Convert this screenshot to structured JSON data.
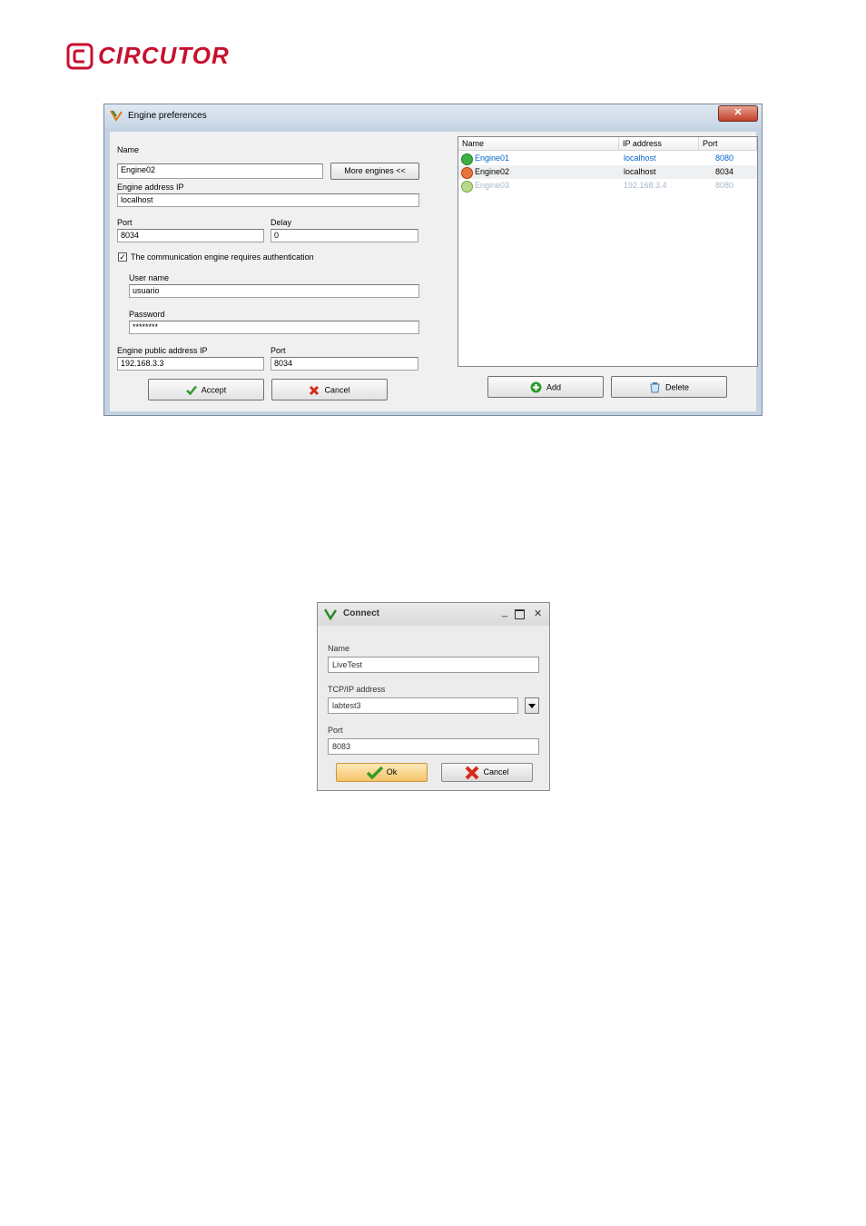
{
  "brand": {
    "name": "CIRCUTOR",
    "color": "#c8102e"
  },
  "engine_prefs": {
    "title": "Engine preferences",
    "close_glyph": "✕",
    "name_label": "Name",
    "name_value": "Engine02",
    "more_engines_label": "More engines <<",
    "address_label": "Engine address IP",
    "address_value": "localhost",
    "port_label": "Port",
    "port_value": "8034",
    "delay_label": "Delay",
    "delay_value": "0",
    "auth_label": "The communication engine requires authentication",
    "auth_checked": true,
    "user_label": "User name",
    "user_value": "usuario",
    "password_label": "Password",
    "password_value": "********",
    "public_ip_label": "Engine public address IP",
    "public_ip_value": "192.168.3.3",
    "public_port_label": "Port",
    "public_port_value": "8034",
    "accept_label": "Accept",
    "cancel_label": "Cancel",
    "add_label": "Add",
    "delete_label": "Delete",
    "list": {
      "columns": [
        "Name",
        "IP address",
        "Port"
      ],
      "rows": [
        {
          "name": "Engine01",
          "ip": "localhost",
          "port": "8080",
          "status": "ok",
          "color": "#0066cc"
        },
        {
          "name": "Engine02",
          "ip": "localhost",
          "port": "8034",
          "status": "error",
          "color": "#000000"
        },
        {
          "name": "Engine03",
          "ip": "192.168.3.4",
          "port": "8080",
          "status": "pending",
          "color": "#a8b8c8"
        }
      ]
    }
  },
  "connect": {
    "title": "Connect",
    "name_label": "Name",
    "name_value": "LiveTest",
    "tcp_label": "TCP/IP address",
    "tcp_value": "labtest3",
    "port_label": "Port",
    "port_value": "8083",
    "ok_label": "Ok",
    "cancel_label": "Cancel"
  }
}
